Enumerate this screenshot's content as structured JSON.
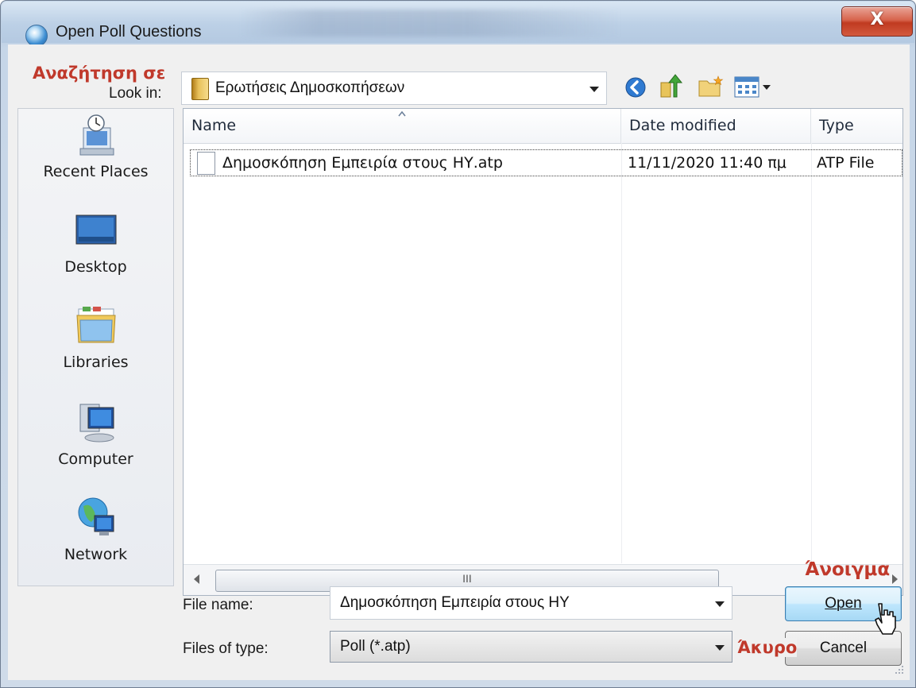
{
  "window": {
    "title": "Open Poll Questions",
    "close_glyph": "X"
  },
  "annotations": {
    "look_in": "Αναζήτηση σε",
    "open": "Άνοιγμα",
    "cancel": "Άκυρο",
    "color": "#c0392b"
  },
  "look_in": {
    "label": "Look in:",
    "value": "Ερωτήσεις Δημοσκοπήσεων"
  },
  "toolbar": {
    "icons": [
      "back-icon",
      "up-folder-icon",
      "new-folder-icon",
      "views-menu-icon"
    ]
  },
  "places": [
    {
      "label": "Recent Places",
      "icon": "recent-places-icon"
    },
    {
      "label": "Desktop",
      "icon": "desktop-icon"
    },
    {
      "label": "Libraries",
      "icon": "libraries-icon"
    },
    {
      "label": "Computer",
      "icon": "computer-icon"
    },
    {
      "label": "Network",
      "icon": "network-icon"
    }
  ],
  "file_list": {
    "columns": [
      "Name",
      "Date modified",
      "Type"
    ],
    "sort_indicator": "^",
    "rows": [
      {
        "name": "Δημοσκόπηση Εμπειρία στους ΗΥ.atp",
        "date": "11/11/2020 11:40 πμ",
        "type": "ATP File"
      }
    ],
    "scroll_thumb_glyph": "III"
  },
  "file_name": {
    "label": "File name:",
    "value": "Δημοσκόπηση Εμπειρία στους ΗΥ"
  },
  "file_type": {
    "label": "Files of type:",
    "value": "Poll (*.atp)"
  },
  "buttons": {
    "open": "Open",
    "cancel": "Cancel"
  }
}
